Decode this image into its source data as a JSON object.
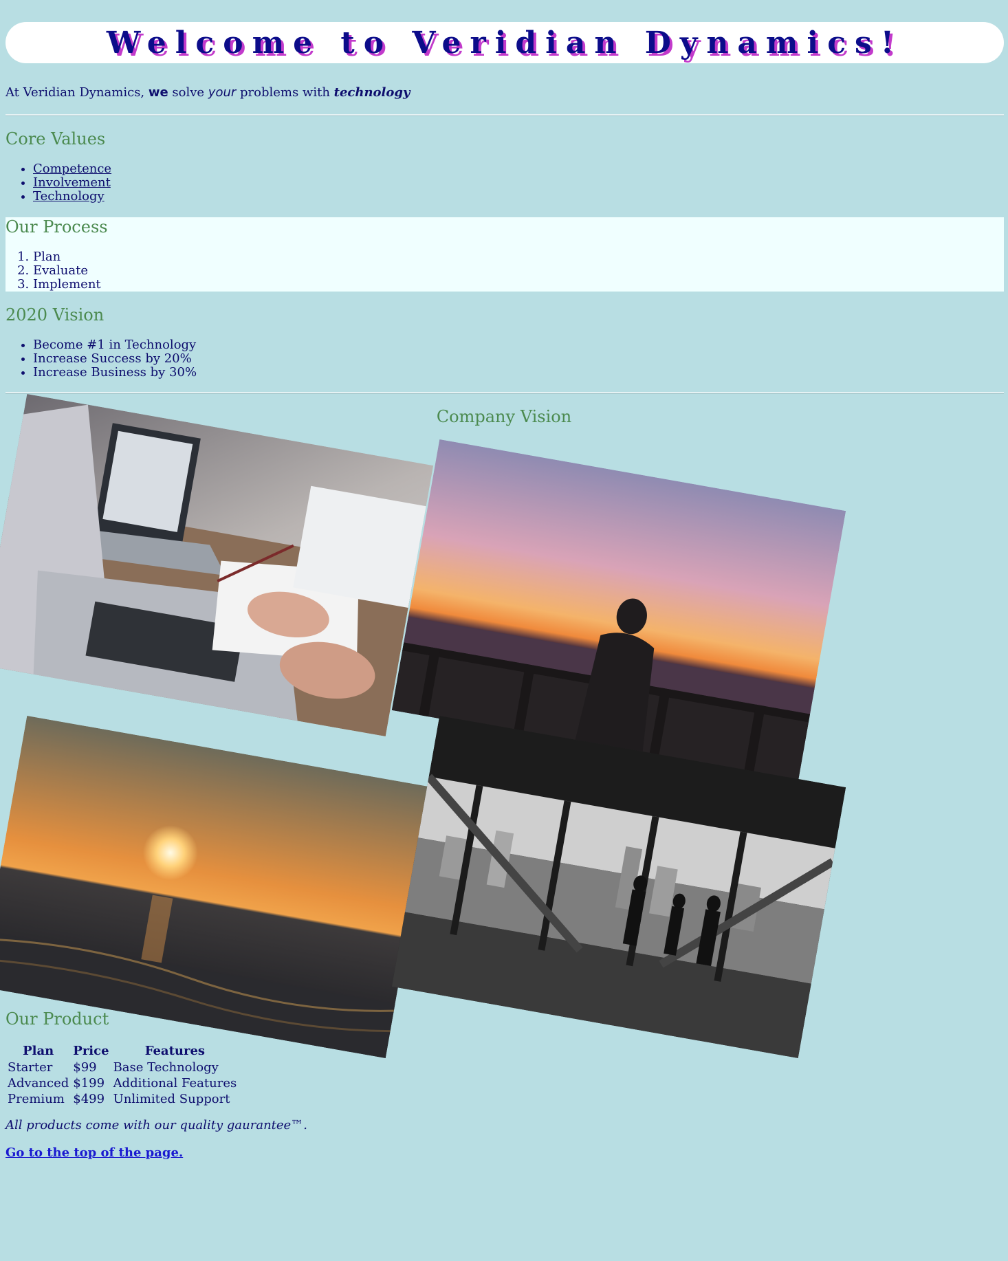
{
  "header": {
    "title": "Welcome to Veridian Dynamics!"
  },
  "intro": {
    "part1": "At Veridian Dynamics, ",
    "we": "we",
    "part2": " solve ",
    "your": "your",
    "part3": " problems with ",
    "technology": "technology"
  },
  "core_values": {
    "heading": "Core Values",
    "items": [
      {
        "label": "Competence"
      },
      {
        "label": "Involvement"
      },
      {
        "label": "Technology"
      }
    ]
  },
  "process": {
    "heading": "Our Process",
    "steps": [
      {
        "label": "Plan"
      },
      {
        "label": "Evaluate"
      },
      {
        "label": "Implement"
      }
    ]
  },
  "vision_2020": {
    "heading": "2020 Vision",
    "items": [
      {
        "label": "Become #1 in Technology"
      },
      {
        "label": "Increase Success by 20%"
      },
      {
        "label": "Increase Business by 30%"
      }
    ]
  },
  "company_vision": {
    "heading": "Company Vision",
    "photos": [
      {
        "subject": "laptops-meeting"
      },
      {
        "subject": "sunset-silhouette"
      },
      {
        "subject": "sunset-ocean"
      },
      {
        "subject": "office-city-view"
      }
    ]
  },
  "product": {
    "heading": "Our Product",
    "columns": [
      "Plan",
      "Price",
      "Features"
    ],
    "rows": [
      [
        "Starter",
        "$99",
        "Base Technology"
      ],
      [
        "Advanced",
        "$199",
        "Additional Features"
      ],
      [
        "Premium",
        "$499",
        "Unlimited Support"
      ]
    ],
    "guarantee": "All products come with our quality gaurantee™.",
    "top_link": "Go to the top of the page."
  },
  "colors": {
    "background": "#b8dee3",
    "text": "#0e0e6e",
    "heading": "#4b8a4f",
    "title": "#0c0c8a",
    "title_shadow": "#c23acb",
    "link": "#1a1ad0",
    "process_bg": "#f0ffff"
  }
}
